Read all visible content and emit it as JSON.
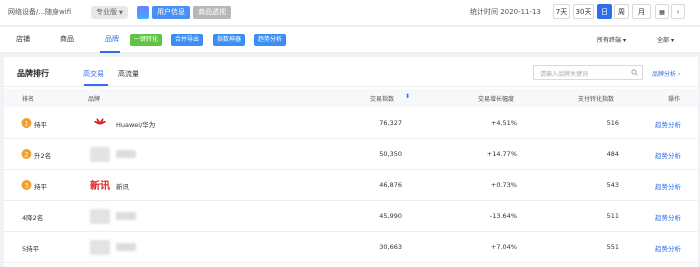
{
  "topbar": {
    "breadcrumb": "网络设备/...随身wifi",
    "edition": "专业版",
    "user_info": "用户信息",
    "goods_insight": "商品透视",
    "stat_time": "统计时间 2020-11-13",
    "ranges": [
      "7天",
      "30天",
      "日",
      "周",
      "月"
    ],
    "active_range": "日"
  },
  "tabs": {
    "store": "店铺",
    "goods": "商品",
    "brand": "品牌",
    "active": "品牌"
  },
  "tools": [
    "一键转化",
    "合并导出",
    "指数神器",
    "趋势分析"
  ],
  "filters": {
    "terminal": "所有终端",
    "all": "全部"
  },
  "panel": {
    "title": "品牌排行",
    "sub_tabs": [
      "高交易",
      "高流量"
    ],
    "active_sub_tab": "高交易",
    "search_placeholder": "请输入品牌关键词",
    "brand_analysis": "品牌分析"
  },
  "table": {
    "headers": [
      "排名",
      "品牌",
      "交易指数",
      "交易增长幅度",
      "支付转化指数",
      "操作"
    ],
    "rows": [
      {
        "rank": "1",
        "rank_change": "持平",
        "brand": "Huawei/华为",
        "trade_index": "76,327",
        "growth": "+4.51%",
        "conversion": "516",
        "action": "趋势分析"
      },
      {
        "rank": "2",
        "rank_change": "升2名",
        "brand": "",
        "trade_index": "50,350",
        "growth": "+14.77%",
        "conversion": "484",
        "action": "趋势分析"
      },
      {
        "rank": "3",
        "rank_change": "持平",
        "brand": "新讯",
        "trade_index": "46,876",
        "growth": "+0.73%",
        "conversion": "543",
        "action": "趋势分析"
      },
      {
        "rank": "",
        "rank_change": "4降2名",
        "brand": "",
        "trade_index": "45,990",
        "growth": "-13.64%",
        "conversion": "511",
        "action": "趋势分析"
      },
      {
        "rank": "",
        "rank_change": "5持平",
        "brand": "",
        "trade_index": "30,663",
        "growth": "+7.04%",
        "conversion": "551",
        "action": "趋势分析"
      }
    ],
    "xinxun_logo_text": "新讯"
  },
  "colors": {
    "accent": "#2f6fe8",
    "green": "#5ec441",
    "badge_gold": "#f0a030",
    "huawei_red": "#e02020"
  }
}
